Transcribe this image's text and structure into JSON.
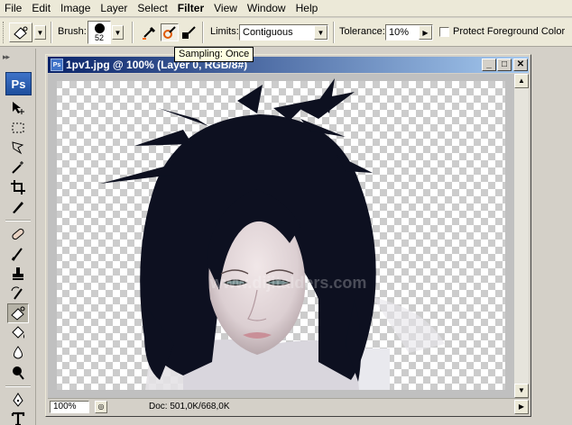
{
  "menu": [
    "File",
    "Edit",
    "Image",
    "Layer",
    "Select",
    "Filter",
    "View",
    "Window",
    "Help"
  ],
  "options": {
    "brush_label": "Brush:",
    "brush_size": "52",
    "limits_label": "Limits:",
    "limits_value": "Contiguous",
    "tolerance_label": "Tolerance:",
    "tolerance_value": "10%",
    "protect_label": "Protect Foreground Color",
    "protect_checked": false
  },
  "tooltip": "Sampling: Once",
  "toolbox": {
    "grip": "▸▸",
    "logo": "Ps",
    "selected_tool": "background-eraser"
  },
  "document": {
    "title": "1pv1.jpg @ 100% (Layer 0, RGB/8#)",
    "title_icon": "Ps",
    "watermark": "www.dijitalders.com",
    "zoom": "100%",
    "doc_info": "Doc: 501,0K/668,0K"
  },
  "window_buttons": {
    "minimize": "_",
    "maximize": "□",
    "close": "✕"
  },
  "colors": {
    "titlebar_start": "#0a246a",
    "titlebar_end": "#a6caf0",
    "ui_face": "#d4d0c8",
    "tooltip_bg": "#ffffe1",
    "hair": "#0d1020"
  }
}
